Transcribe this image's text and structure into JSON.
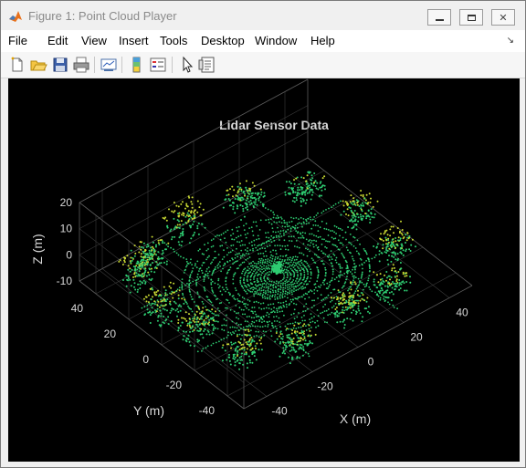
{
  "window": {
    "title": "Figure 1: Point Cloud Player"
  },
  "menu": [
    "File",
    "Edit",
    "View",
    "Insert",
    "Tools",
    "Desktop",
    "Window",
    "Help"
  ],
  "toolbar": {
    "buttons": [
      "new-figure-icon",
      "open-file-icon",
      "save-icon",
      "print-icon",
      "link-plot-icon",
      "insert-colorbar-icon",
      "insert-legend-icon",
      "pointer-icon",
      "property-inspector-icon"
    ]
  },
  "chart_data": {
    "type": "scatter",
    "title": "Lidar Sensor Data",
    "xlabel": "X (m)",
    "ylabel": "Y (m)",
    "zlabel": "Z (m)",
    "x_ticks": [
      "-40",
      "-20",
      "0",
      "20",
      "40"
    ],
    "y_ticks": [
      "40",
      "20",
      "0",
      "-20",
      "-40"
    ],
    "z_ticks": [
      "20",
      "10",
      "0",
      "-10"
    ],
    "xlim": [
      -50,
      50
    ],
    "ylim": [
      -50,
      50
    ],
    "zlim": [
      -10,
      20
    ],
    "grid": true,
    "colors": {
      "background": "#000000",
      "low": "#2ecc71",
      "mid": "#c8d832",
      "high": "#f2a020",
      "axis": "#d8d8d8",
      "grid": "#3a3a3a"
    }
  }
}
